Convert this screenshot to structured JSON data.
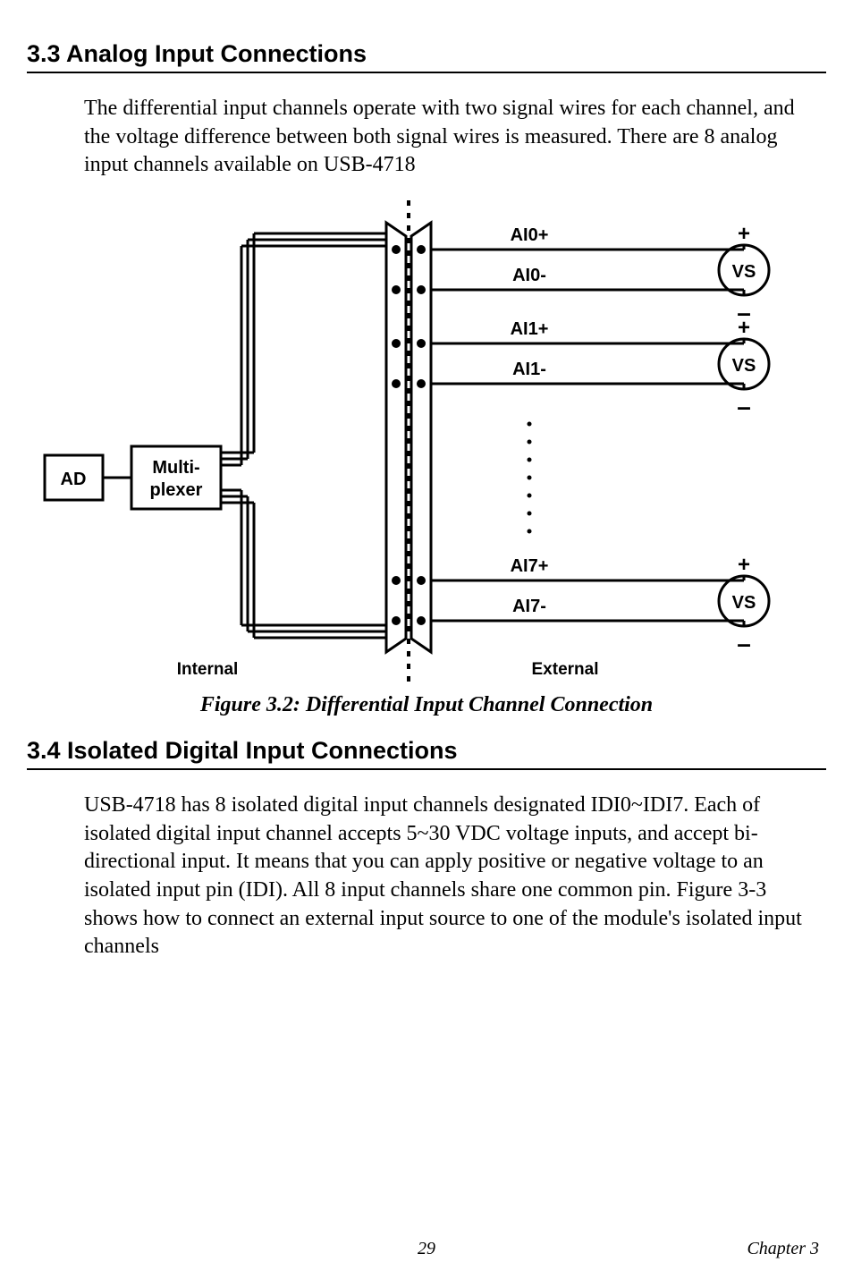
{
  "section33": {
    "heading": "3.3  Analog Input Connections",
    "body": "The differential input channels operate with two signal wires for each channel, and the voltage difference between both signal wires is measured. There are 8 analog input channels available on USB-4718"
  },
  "figure": {
    "ad": "AD",
    "mux1": "Multi-",
    "mux2": "plexer",
    "ai0p": "AI0+",
    "ai0m": "AI0-",
    "ai1p": "AI1+",
    "ai1m": "AI1-",
    "ai7p": "AI7+",
    "ai7m": "AI7-",
    "vs": "VS",
    "internal": "Internal",
    "external": "External",
    "caption": "Figure 3.2: Differential Input Channel Connection"
  },
  "section34": {
    "heading": "3.4  Isolated Digital Input Connections",
    "body": "USB-4718 has 8 isolated digital input channels designated IDI0~IDI7. Each of isolated digital input channel accepts 5~30 VDC voltage inputs, and accept bi-directional input. It means that you can apply positive or negative voltage to an isolated input pin (IDI). All 8 input channels share one common pin. Figure 3-3 shows how to connect an external input source to one of the module's isolated input channels"
  },
  "footer": {
    "page": "29",
    "chapter": "Chapter 3"
  }
}
